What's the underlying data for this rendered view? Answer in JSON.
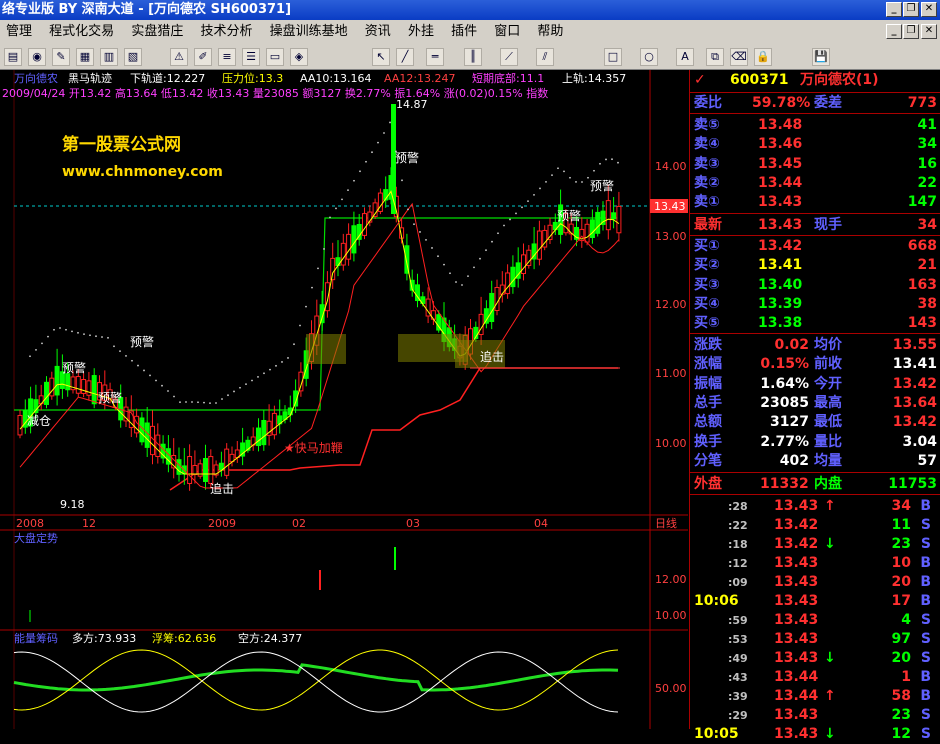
{
  "window": {
    "title": "络专业版 BY 深南大道 - [万向德农  SH600371]",
    "btn_min": "_",
    "btn_max": "❐",
    "btn_close": "✕"
  },
  "menu": [
    "管理",
    "程式化交易",
    "实盘猎庄",
    "技术分析",
    "操盘训练基地",
    "资讯",
    "外挂",
    "插件",
    "窗口",
    "帮助"
  ],
  "menu_right": {
    "btn_min": "_",
    "btn_max": "❐",
    "btn_close": "✕"
  },
  "toolbar_icons": [
    "folder-icon",
    "camera-icon",
    "pen-icon",
    "grid-icon",
    "table-icon",
    "chart-icon",
    "alarm-icon",
    "pencil-icon",
    "lines-icon",
    "list-icon",
    "window-icon",
    "signal-icon",
    "cursor-icon",
    "line-tool-icon",
    "hline-icon",
    "vline-icon",
    "fan-icon",
    "channel-icon",
    "rect-icon",
    "ellipse-icon",
    "text-icon",
    "copy-icon",
    "erase-icon",
    "lock-icon",
    "save-icon"
  ],
  "main_chart": {
    "indicator_name": "万向德农",
    "indicator_type": "黑马轨迹",
    "lower_rail": "下轨道:12.227",
    "pressure": "压力位:13.3",
    "aa10": "AA10:13.164",
    "aa12": "AA12:13.247",
    "short_bottom": "短期底部:11.1",
    "upper_rail": "上轨:14.357",
    "info_line": "2009/04/24  开13.42  高13.64  低13.42  收13.43  量23085  额3127  换2.77%  振1.64%  涨(0.02)0.15%  指数",
    "watermark1": "第一股票公式网",
    "watermark2": "www.chnmoney.com",
    "price_labels": [
      "14.00",
      "13.00",
      "12.00",
      "11.00",
      "10.00"
    ],
    "current_price": "13.43",
    "high_mark": "14.87",
    "low_mark": "9.18",
    "annotations": {
      "warn": "预警",
      "chase": "追击",
      "accel": "★快马加鞭",
      "reduce": "减仓"
    },
    "dates": [
      "2008",
      "12",
      "2009",
      "02",
      "03",
      "04"
    ],
    "period": "日线"
  },
  "market_panel": {
    "title": "大盘定势",
    "labels": [
      "12.00",
      "10.00"
    ]
  },
  "energy_panel": {
    "title": "能量筹码",
    "bull": "多方:73.933",
    "float": "浮筹:62.636",
    "bear": "空方:24.377",
    "label": "50.00"
  },
  "quote": {
    "code": "600371",
    "name": "万向德农(1)",
    "ratio_label": "委比",
    "ratio_value": "59.78%",
    "diff_label": "委差",
    "diff_value": "773",
    "sells": [
      {
        "label": "卖⑤",
        "price": "13.48",
        "vol": "41"
      },
      {
        "label": "卖④",
        "price": "13.46",
        "vol": "34"
      },
      {
        "label": "卖③",
        "price": "13.45",
        "vol": "16"
      },
      {
        "label": "卖②",
        "price": "13.44",
        "vol": "22"
      },
      {
        "label": "卖①",
        "price": "13.43",
        "vol": "147"
      }
    ],
    "latest_label": "最新",
    "latest_value": "13.43",
    "hand_label": "现手",
    "hand_value": "34",
    "buys": [
      {
        "label": "买①",
        "price": "13.42",
        "vol": "668"
      },
      {
        "label": "买②",
        "price": "13.41",
        "vol": "21"
      },
      {
        "label": "买③",
        "price": "13.40",
        "vol": "163"
      },
      {
        "label": "买④",
        "price": "13.39",
        "vol": "38"
      },
      {
        "label": "买⑤",
        "price": "13.38",
        "vol": "143"
      }
    ],
    "stats": [
      {
        "l1": "涨跌",
        "v1": "0.02",
        "l2": "均价",
        "v2": "13.55"
      },
      {
        "l1": "涨幅",
        "v1": "0.15%",
        "l2": "前收",
        "v2": "13.41"
      },
      {
        "l1": "振幅",
        "v1": "1.64%",
        "l2": "今开",
        "v2": "13.42"
      },
      {
        "l1": "总手",
        "v1": "23085",
        "l2": "最高",
        "v2": "13.64"
      },
      {
        "l1": "总额",
        "v1": "3127",
        "l2": "最低",
        "v2": "13.42"
      },
      {
        "l1": "换手",
        "v1": "2.77%",
        "l2": "量比",
        "v2": "3.04"
      },
      {
        "l1": "分笔",
        "v1": "402",
        "l2": "均量",
        "v2": "57"
      }
    ],
    "outer_label": "外盘",
    "outer_value": "11332",
    "inner_label": "内盘",
    "inner_value": "11753"
  },
  "ticks": [
    {
      "time": ":28",
      "price": "13.43",
      "arrow": "↑",
      "vol": "34",
      "bs": "B"
    },
    {
      "time": ":22",
      "price": "13.42",
      "arrow": "",
      "vol": "11",
      "bs": "S"
    },
    {
      "time": ":18",
      "price": "13.42",
      "arrow": "↓",
      "vol": "23",
      "bs": "S"
    },
    {
      "time": ":12",
      "price": "13.43",
      "arrow": "",
      "vol": "10",
      "bs": "B"
    },
    {
      "time": ":09",
      "price": "13.43",
      "arrow": "",
      "vol": "20",
      "bs": "B"
    },
    {
      "time": "10:06",
      "price": "13.43",
      "arrow": "",
      "vol": "17",
      "bs": "B"
    },
    {
      "time": ":59",
      "price": "13.43",
      "arrow": "",
      "vol": "4",
      "bs": "S"
    },
    {
      "time": ":53",
      "price": "13.43",
      "arrow": "",
      "vol": "97",
      "bs": "S"
    },
    {
      "time": ":49",
      "price": "13.43",
      "arrow": "↓",
      "vol": "20",
      "bs": "S"
    },
    {
      "time": ":43",
      "price": "13.44",
      "arrow": "",
      "vol": "1",
      "bs": "B"
    },
    {
      "time": ":39",
      "price": "13.44",
      "arrow": "↑",
      "vol": "58",
      "bs": "B"
    },
    {
      "time": ":29",
      "price": "13.43",
      "arrow": "",
      "vol": "23",
      "bs": "S"
    },
    {
      "time": "10:05",
      "price": "13.43",
      "arrow": "↓",
      "vol": "12",
      "bs": "S"
    }
  ],
  "colors": {
    "up": "#ff3030",
    "down": "#00ff00",
    "yellow": "#ffff00",
    "cyan": "#00ffff",
    "label": "#ff5050",
    "blue": "#6060ff",
    "magenta": "#ff40ff"
  }
}
